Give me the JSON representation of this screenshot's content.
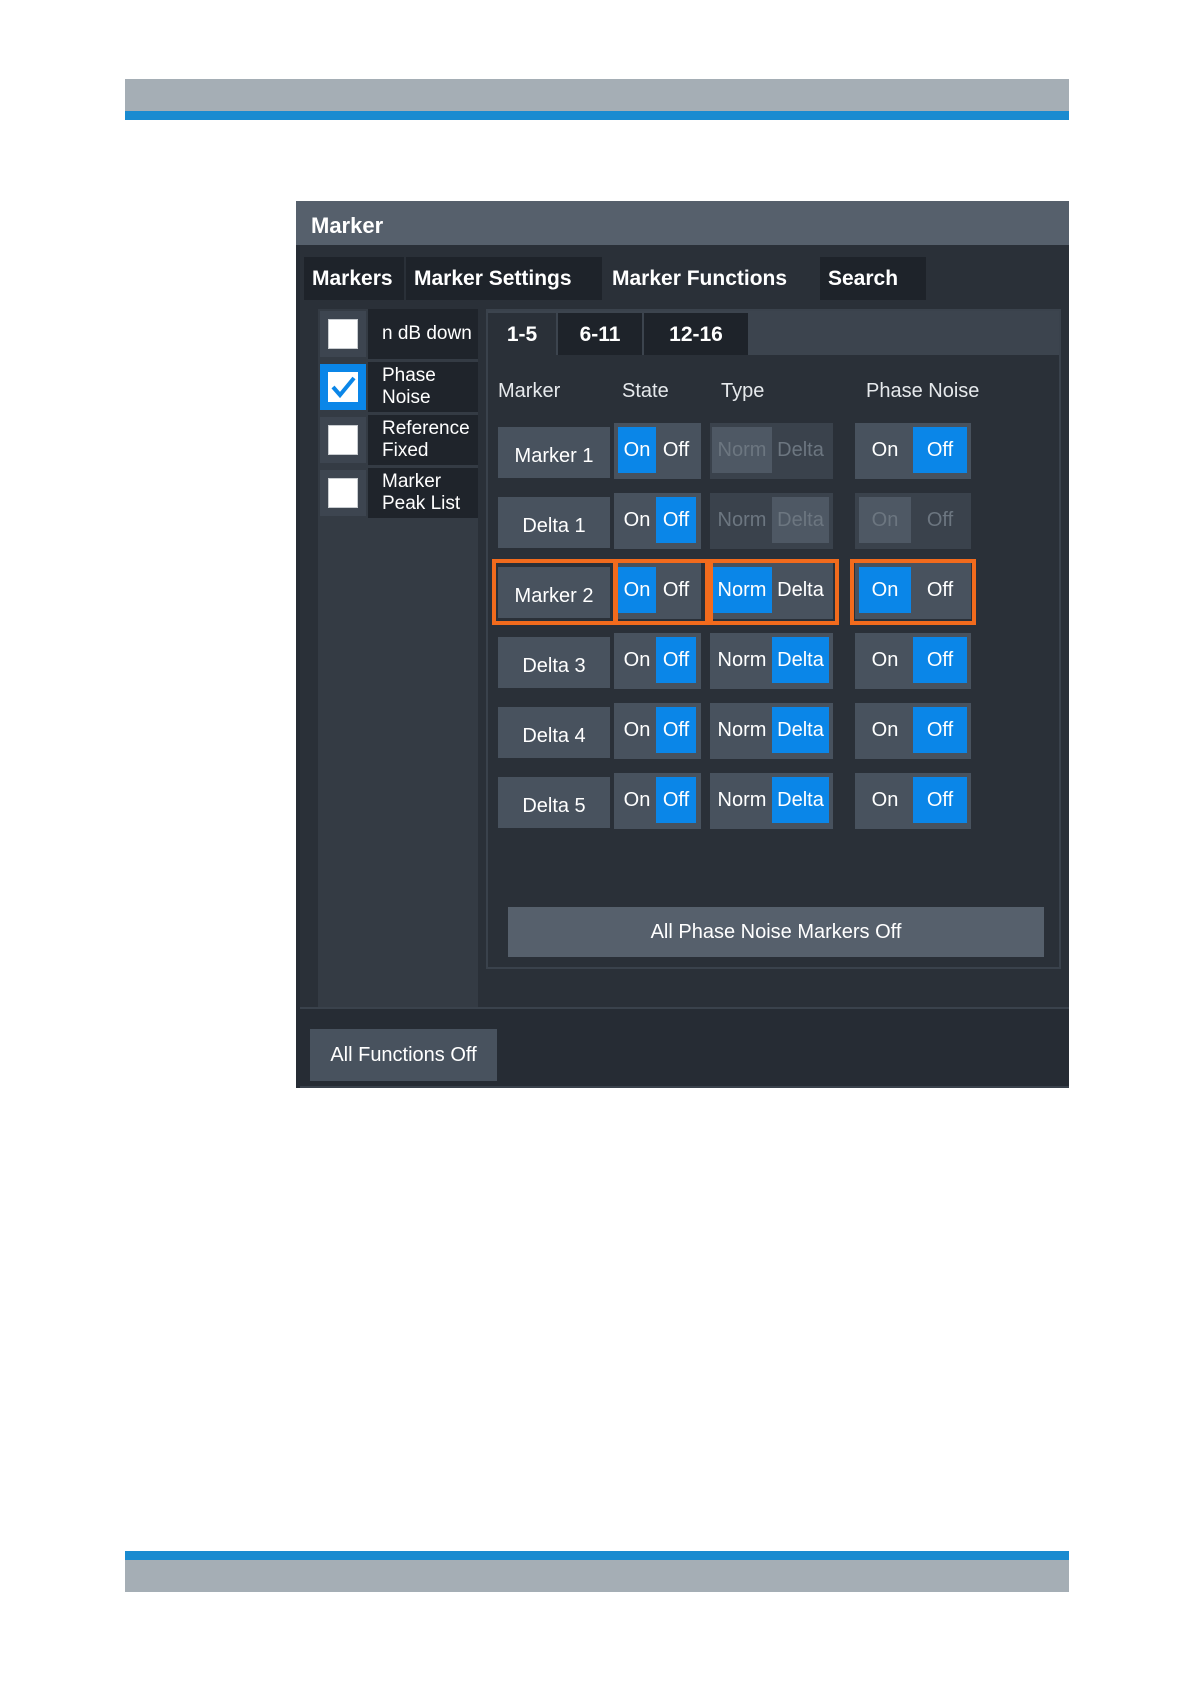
{
  "dialog": {
    "title": "Marker"
  },
  "tabs": [
    {
      "label": "Markers"
    },
    {
      "label": "Marker Settings"
    },
    {
      "label": "Marker Functions"
    },
    {
      "label": "Search"
    }
  ],
  "functions": [
    {
      "line1": "n dB down",
      "line2": "",
      "checked": false
    },
    {
      "line1": "Phase",
      "line2": "Noise",
      "checked": true
    },
    {
      "line1": "Reference",
      "line2": "Fixed",
      "checked": false
    },
    {
      "line1": "Marker",
      "line2": "Peak List",
      "checked": false
    }
  ],
  "subtabs": [
    "1-5",
    "6-11",
    "12-16"
  ],
  "columns": {
    "marker": "Marker",
    "state": "State",
    "type": "Type",
    "phase_noise": "Phase Noise"
  },
  "toggle_labels": {
    "on": "On",
    "off": "Off",
    "norm": "Norm",
    "delta": "Delta"
  },
  "rows": [
    {
      "label": "Marker 1",
      "state": "On",
      "type": "Norm",
      "type_enabled": false,
      "phase_noise": "Off",
      "pn_enabled": true,
      "highlighted": false
    },
    {
      "label": "Delta 1",
      "state": "Off",
      "type": "Delta",
      "type_enabled": false,
      "phase_noise": "On",
      "pn_enabled": false,
      "highlighted": false
    },
    {
      "label": "Marker 2",
      "state": "On",
      "type": "Norm",
      "type_enabled": true,
      "phase_noise": "On",
      "pn_enabled": true,
      "highlighted": true
    },
    {
      "label": "Delta 3",
      "state": "Off",
      "type": "Delta",
      "type_enabled": true,
      "phase_noise": "Off",
      "pn_enabled": true,
      "highlighted": false
    },
    {
      "label": "Delta 4",
      "state": "Off",
      "type": "Delta",
      "type_enabled": true,
      "phase_noise": "Off",
      "pn_enabled": true,
      "highlighted": false
    },
    {
      "label": "Delta 5",
      "state": "Off",
      "type": "Delta",
      "type_enabled": true,
      "phase_noise": "Off",
      "pn_enabled": true,
      "highlighted": false
    }
  ],
  "buttons": {
    "all_phase_noise_off": "All Phase Noise Markers Off",
    "all_functions_off": "All Functions Off"
  },
  "colors": {
    "accent": "#0a86e8",
    "highlight": "#f26b1d",
    "header_band": "#a5aeb5",
    "rule_blue": "#1a8bd0"
  }
}
